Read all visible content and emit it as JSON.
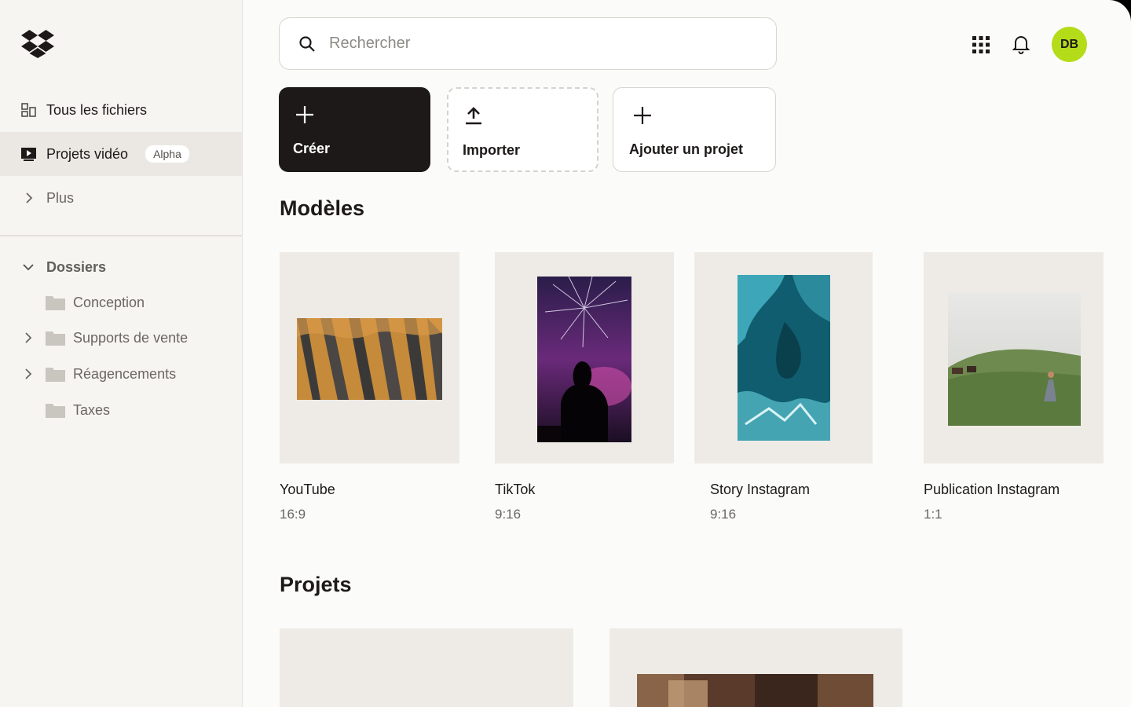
{
  "sidebar": {
    "nav": [
      {
        "label": "Tous les fichiers",
        "icon": "files-icon"
      },
      {
        "label": "Projets vidéo",
        "icon": "video-project-icon",
        "badge": "Alpha"
      },
      {
        "label": "Plus",
        "icon": "chevron-right-icon"
      }
    ],
    "folders_heading": "Dossiers",
    "folders": [
      {
        "label": "Conception",
        "expandable": false
      },
      {
        "label": "Supports de vente",
        "expandable": true
      },
      {
        "label": "Réagencements",
        "expandable": true
      },
      {
        "label": "Taxes",
        "expandable": false
      }
    ]
  },
  "header": {
    "search_placeholder": "Rechercher",
    "avatar_initials": "DB"
  },
  "actions": {
    "create": "Créer",
    "import": "Importer",
    "add_project": "Ajouter un projet"
  },
  "templates": {
    "title": "Modèles",
    "items": [
      {
        "name": "YouTube",
        "ratio": "16:9"
      },
      {
        "name": "TikTok",
        "ratio": "9:16"
      },
      {
        "name": "Story Instagram",
        "ratio": "9:16"
      },
      {
        "name": "Publication Instagram",
        "ratio": "1:1"
      }
    ]
  },
  "projects": {
    "title": "Projets"
  },
  "colors": {
    "accent_avatar": "#b4dc19",
    "create_button": "#1e1919",
    "sidebar_bg": "#f7f5f2"
  }
}
